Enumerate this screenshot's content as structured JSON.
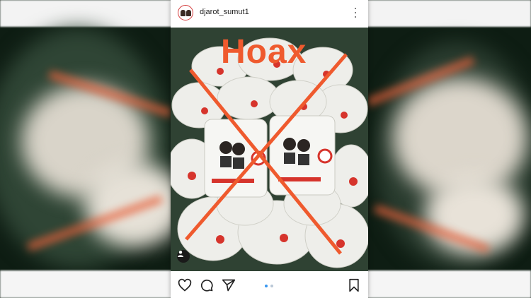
{
  "post": {
    "username": "djarot_sumut1",
    "overlay_text": "Hoax",
    "image_description_hidden": "",
    "icons": {
      "more": "more-vertical-icon",
      "like": "heart-icon",
      "comment": "comment-icon",
      "share": "send-icon",
      "save": "bookmark-icon",
      "tag": "user-tag-icon"
    },
    "carousel": {
      "count": 2,
      "active_index": 1
    }
  },
  "colors": {
    "overlay": "#ef5a2e",
    "active_dot": "#3897f0",
    "inactive_dot": "#b9c7d6"
  }
}
